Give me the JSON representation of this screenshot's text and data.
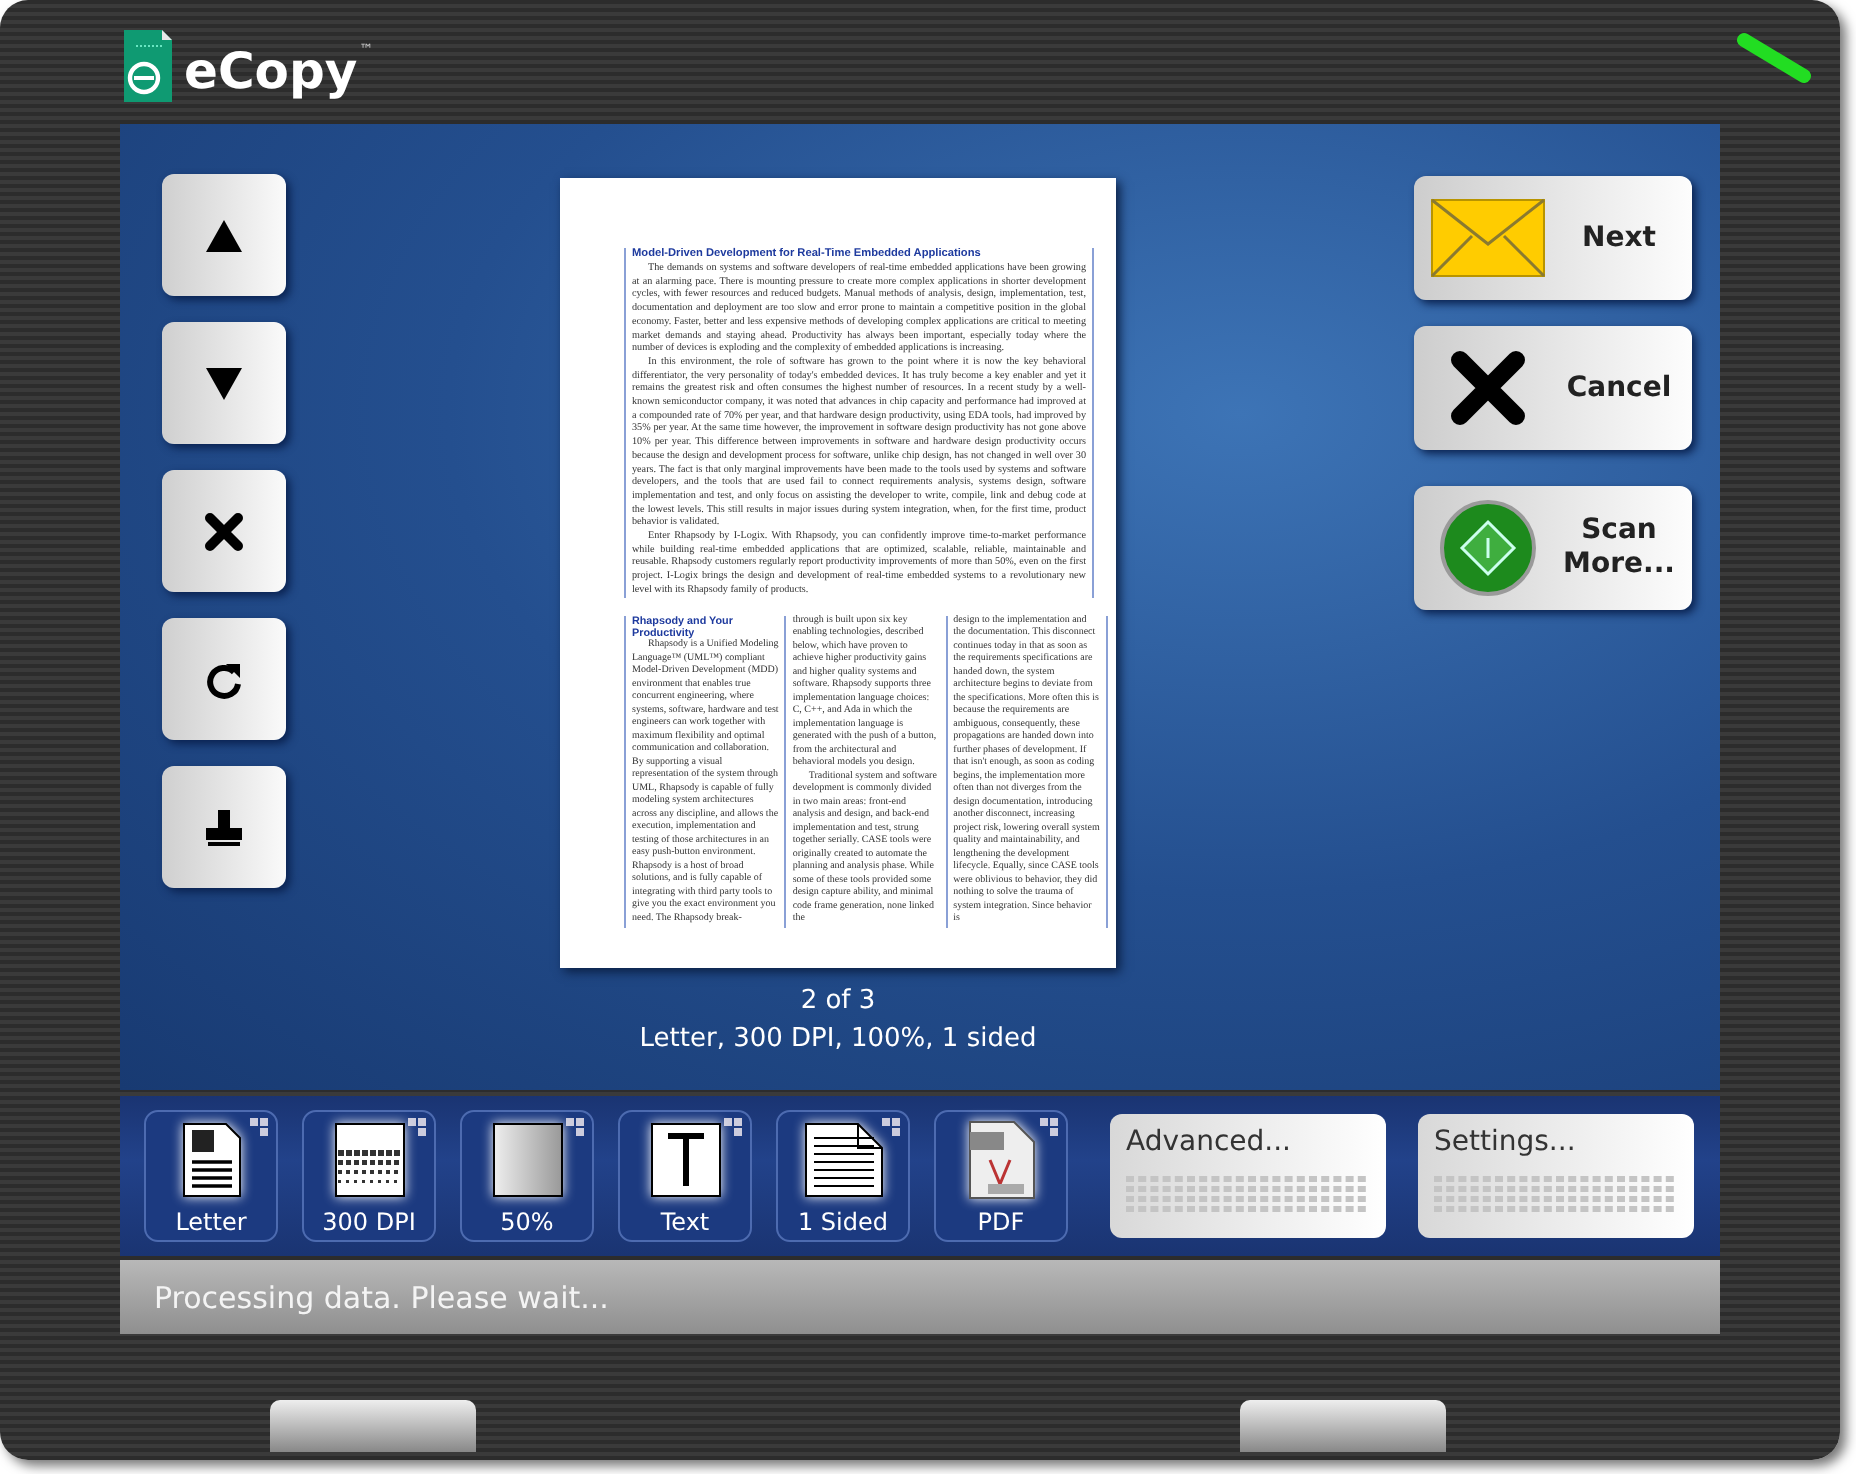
{
  "header": {
    "logo_text": "eCopy",
    "logo_mark": "™"
  },
  "document": {
    "title": "Model-Driven Development for Real-Time Embedded Applications",
    "paragraphs": [
      "The demands on systems and software developers of real-time embedded applications have been growing at an alarming pace. There is mounting pressure to create more complex applications in shorter development cycles, with fewer resources and reduced budgets. Manual methods of analysis, design, implementation, test, documentation and deployment are too slow and error prone to maintain a competitive position in the global economy. Faster, better and less expensive methods of developing complex applications are critical to meeting market demands and staying ahead. Productivity has always been important, especially today where the number of devices is exploding and the complexity of embedded applications is increasing.",
      "In this environment, the role of software has grown to the point where it is now the key behavioral differentiator, the very personality of today's embedded devices. It has truly become a key enabler and yet it remains the greatest risk and often consumes the highest number of resources. In a recent study by a well-known semiconductor company, it was noted that advances in chip capacity and performance had improved at a compounded rate of 70% per year, and that hardware design productivity, using EDA tools, had improved by 35% per year. At the same time however, the improvement in software design productivity has not gone above 10% per year. This difference between improvements in software and hardware design productivity occurs because the design and development process for software, unlike chip design, has not changed in well over 30 years. The fact is that only marginal improvements have been made to the tools used by systems and software developers, and the tools that are used fail to connect requirements analysis, systems design, software implementation and test, and only focus on assisting the developer to write, compile, link and debug code at the lowest levels. This still results in major issues during system integration, when, for the first time, product behavior is validated.",
      "Enter Rhapsody by I-Logix. With Rhapsody, you can confidently improve time-to-market performance while building real-time embedded applications that are optimized, scalable, reliable, maintainable and reusable. Rhapsody customers regularly report productivity improvements of more than 50%, even on the first project. I-Logix brings the design and development of real-time embedded systems to a revolutionary new level with its Rhapsody family of products."
    ],
    "section_heading": "Rhapsody and Your Productivity",
    "columns": [
      [
        "Rhapsody is a Unified Modeling Language™ (UML™) compliant Model-Driven Development (MDD) environment that enables true concurrent engineering, where systems, software, hardware and test engineers can work together with maximum flexibility and optimal communication and collaboration. By supporting a visual representation of the system through UML, Rhapsody is capable of fully modeling system architectures across any discipline, and allows the execution, implementation and testing of those architectures in an easy push-button environment. Rhapsody is a host of broad solutions, and is fully capable of integrating with third party tools to give you the exact environment you need. The Rhapsody break-"
      ],
      [
        "through is built upon six key enabling technologies, described below, which have proven to achieve higher productivity gains and higher quality systems and software. Rhapsody supports three implementation language choices: C, C++, and Ada in which the implementation language is generated with the push of a button, from the architectural and behavioral models you design.",
        "Traditional system and software development is commonly divided in two main areas: front-end analysis and design, and back-end implementation and test, strung together serially. CASE tools were originally created to automate the planning and analysis phase. While some of these tools provided some design capture ability, and minimal code frame generation, none linked the"
      ],
      [
        "design to the implementation and the documentation. This disconnect continues today in that as soon as the requirements specifications are handed down, the system architecture begins to deviate from the specifications. More often this is because the requirements are ambiguous, consequently, these propagations are handed down into further phases of development. If that isn't enough, as soon as coding begins, the implementation more often than not diverges from the design documentation, introducing another disconnect, increasing project risk, lowering overall system quality and maintainability, and lengthening the development lifecycle. Equally, since CASE tools were oblivious to behavior, they did nothing to solve the trauma of system integration. Since behavior is"
      ]
    ]
  },
  "page_indicator": "2 of 3",
  "page_summary": "Letter, 300 DPI, 100%, 1 sided",
  "actions": [
    {
      "kind": "send",
      "label": "Next"
    },
    {
      "kind": "cancel",
      "label": "Cancel"
    },
    {
      "kind": "scan",
      "label": "Scan More..."
    }
  ],
  "settings": [
    {
      "kind": "paper",
      "label": "Letter"
    },
    {
      "kind": "resolution",
      "label": "300 DPI"
    },
    {
      "kind": "contrast",
      "label": "50%"
    },
    {
      "kind": "text",
      "label": "Text"
    },
    {
      "kind": "sides",
      "label": "1 Sided"
    },
    {
      "kind": "pdf",
      "label": "PDF"
    }
  ],
  "panels": [
    {
      "label": "Advanced..."
    },
    {
      "label": "Settings..."
    }
  ],
  "status": "Processing data. Please wait..."
}
